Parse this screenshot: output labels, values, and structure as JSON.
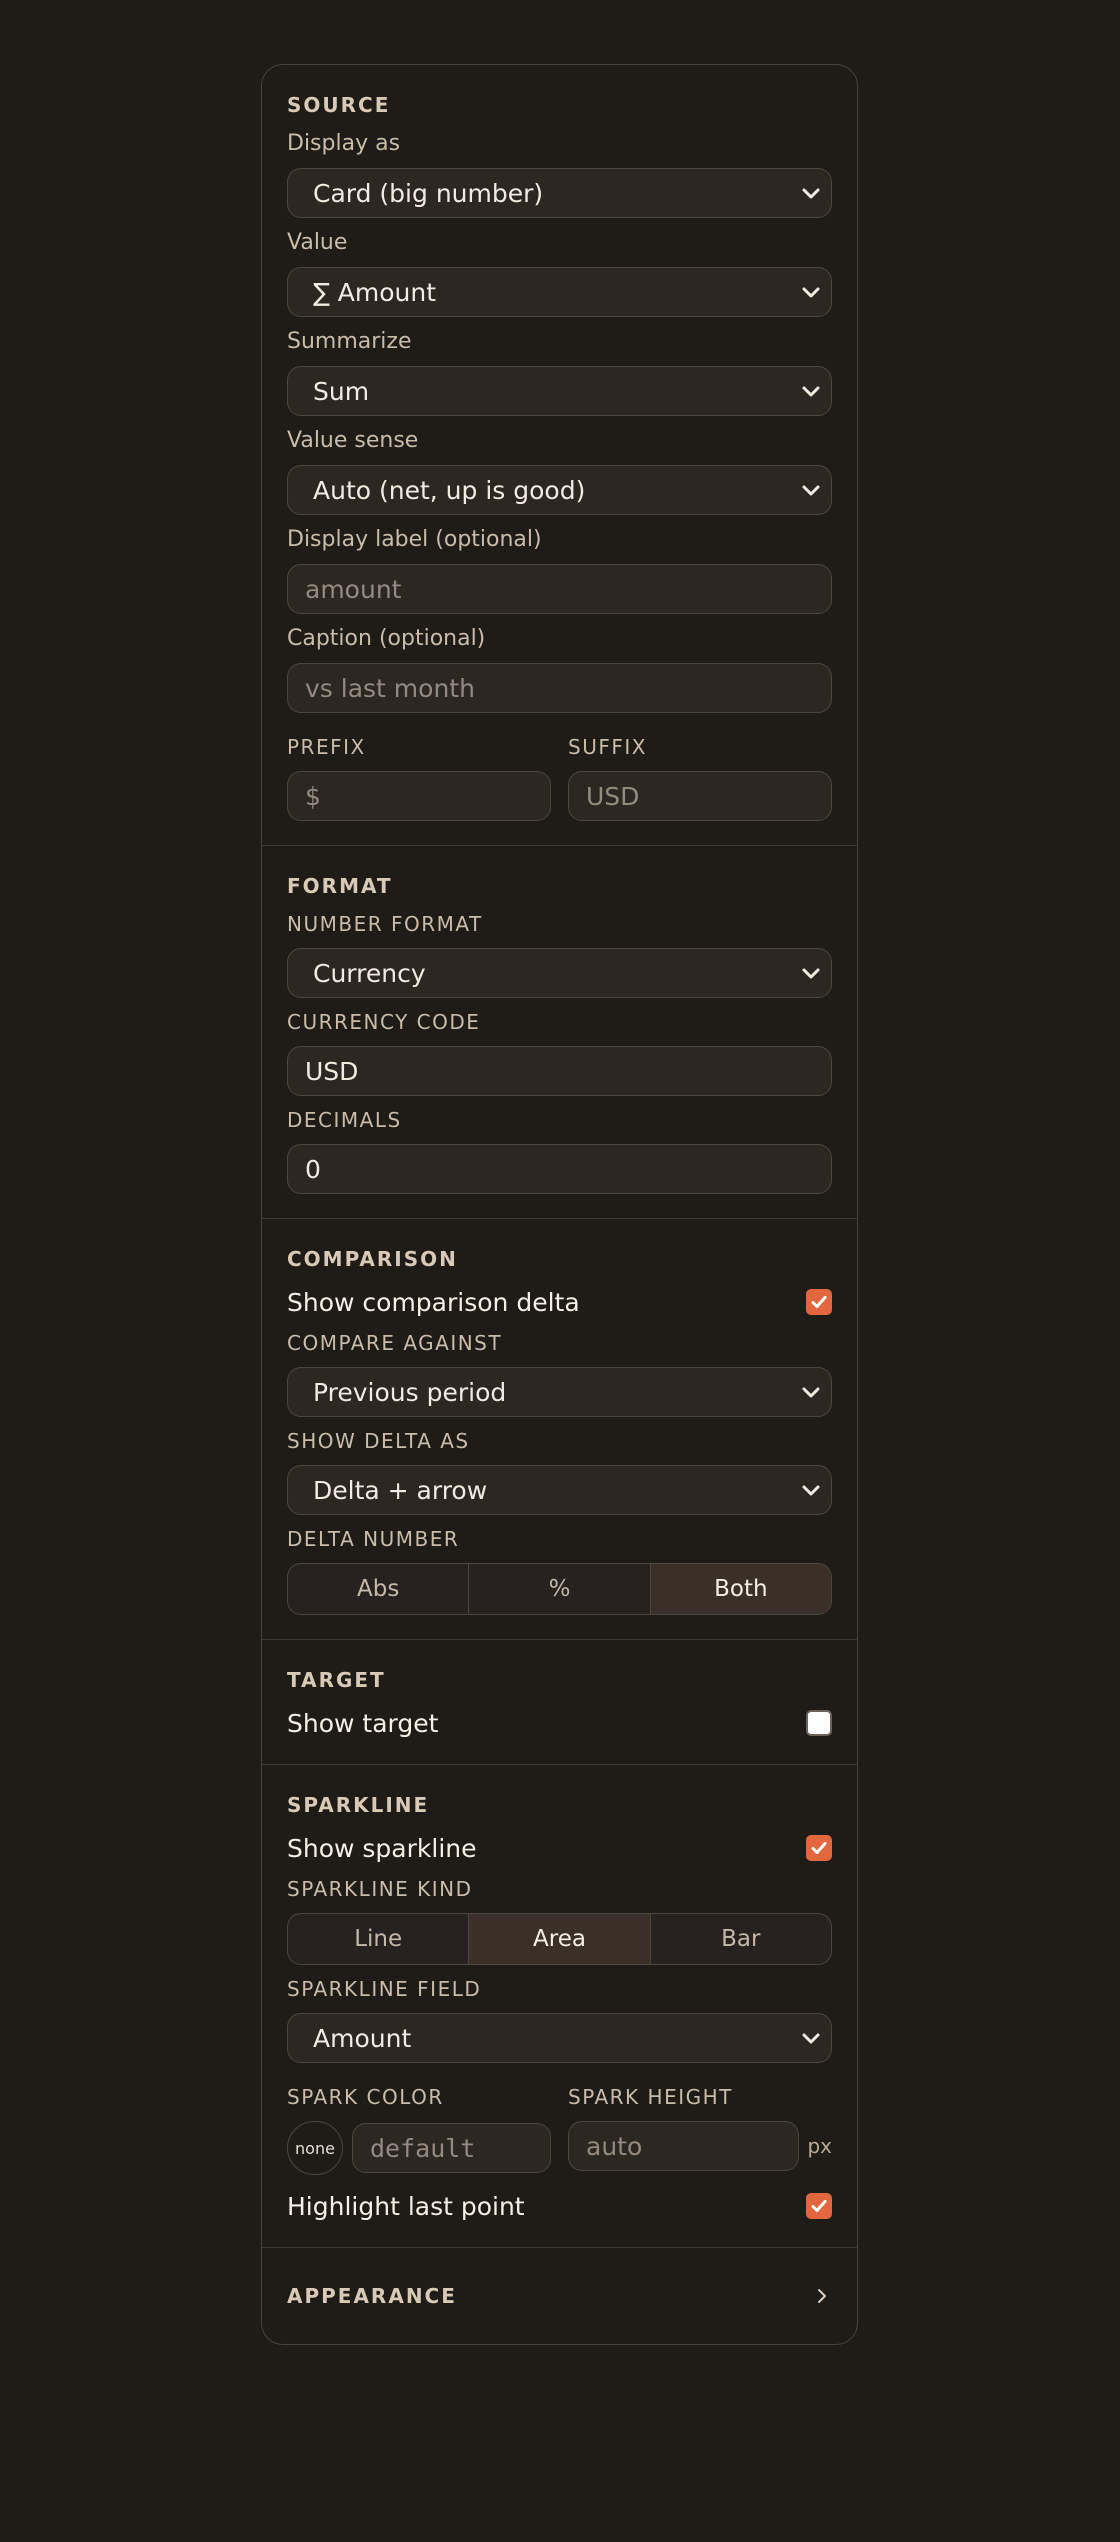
{
  "source": {
    "title": "SOURCE",
    "display_as_label": "Display as",
    "display_as_value": "Card (big number)",
    "value_label": "Value",
    "value_value": "∑ Amount",
    "summarize_label": "Summarize",
    "summarize_value": "Sum",
    "value_sense_label": "Value sense",
    "value_sense_value": "Auto (net, up is good)",
    "display_label_label": "Display label (optional)",
    "display_label_placeholder": "amount",
    "caption_label": "Caption (optional)",
    "caption_placeholder": "vs last month",
    "prefix_label": "PREFIX",
    "prefix_placeholder": "$",
    "suffix_label": "SUFFIX",
    "suffix_placeholder": "USD"
  },
  "format": {
    "title": "FORMAT",
    "number_format_label": "NUMBER FORMAT",
    "number_format_value": "Currency",
    "currency_code_label": "CURRENCY CODE",
    "currency_code_value": "USD",
    "decimals_label": "DECIMALS",
    "decimals_value": "0"
  },
  "comparison": {
    "title": "COMPARISON",
    "show_delta_label": "Show comparison delta",
    "show_delta_checked": true,
    "compare_against_label": "COMPARE AGAINST",
    "compare_against_value": "Previous period",
    "show_delta_as_label": "SHOW DELTA AS",
    "show_delta_as_value": "Delta + arrow",
    "delta_number_label": "DELTA NUMBER",
    "delta_number_options": [
      "Abs",
      "%",
      "Both"
    ],
    "delta_number_selected": "Both"
  },
  "target": {
    "title": "TARGET",
    "show_target_label": "Show target",
    "show_target_checked": false
  },
  "sparkline": {
    "title": "SPARKLINE",
    "show_sparkline_label": "Show sparkline",
    "show_sparkline_checked": true,
    "kind_label": "SPARKLINE KIND",
    "kind_options": [
      "Line",
      "Area",
      "Bar"
    ],
    "kind_selected": "Area",
    "field_label": "SPARKLINE FIELD",
    "field_value": "Amount",
    "color_label": "SPARK COLOR",
    "color_none": "none",
    "color_placeholder": "default",
    "height_label": "SPARK HEIGHT",
    "height_placeholder": "auto",
    "height_unit": "px",
    "highlight_label": "Highlight last point",
    "highlight_checked": true
  },
  "appearance": {
    "title": "APPEARANCE"
  },
  "colors": {
    "background": "#1f1b17",
    "accent": "#e2673f",
    "control_bg": "#2d2722",
    "border": "#4d463d"
  }
}
